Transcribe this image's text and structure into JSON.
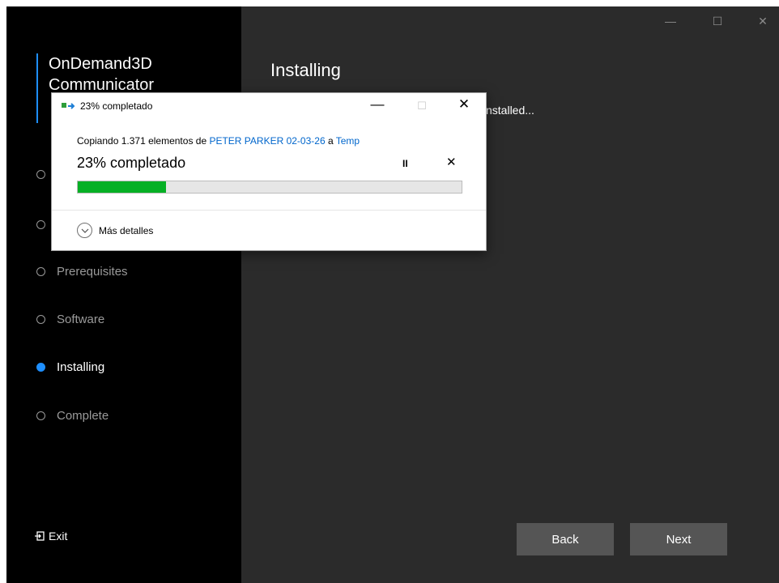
{
  "installer": {
    "brand_line1": "OnDemand3D",
    "brand_line2": "Communicator",
    "steps": [
      {
        "label": "Prerequisites",
        "active": false
      },
      {
        "label": "Software",
        "active": false
      },
      {
        "label": "Installing",
        "active": true
      },
      {
        "label": "Complete",
        "active": false
      }
    ],
    "exit_label": "Exit",
    "page_title": "Installing",
    "status_text": "nstalled...",
    "back_label": "Back",
    "next_label": "Next",
    "window_controls": {
      "minimize": "—",
      "maximize": "☐",
      "close": "✕"
    }
  },
  "copy_dialog": {
    "title": "23% completado",
    "copying_prefix": "Copiando 1.371 elementos de ",
    "source": "PETER PARKER 02-03-26",
    "connector": " a ",
    "destination": "Temp",
    "percent_text": "23% completado",
    "progress": 0.23,
    "pause_symbol": "II",
    "cancel_symbol": "✕",
    "details_label": "Más detalles",
    "controls": {
      "minimize": "—",
      "maximize": "☐",
      "close": "✕"
    }
  },
  "colors": {
    "accent": "#1e8fff",
    "progress_fill": "#06b025",
    "link": "#0066cc",
    "sidebar_bg": "#000000",
    "content_bg": "#2b2b2b"
  }
}
